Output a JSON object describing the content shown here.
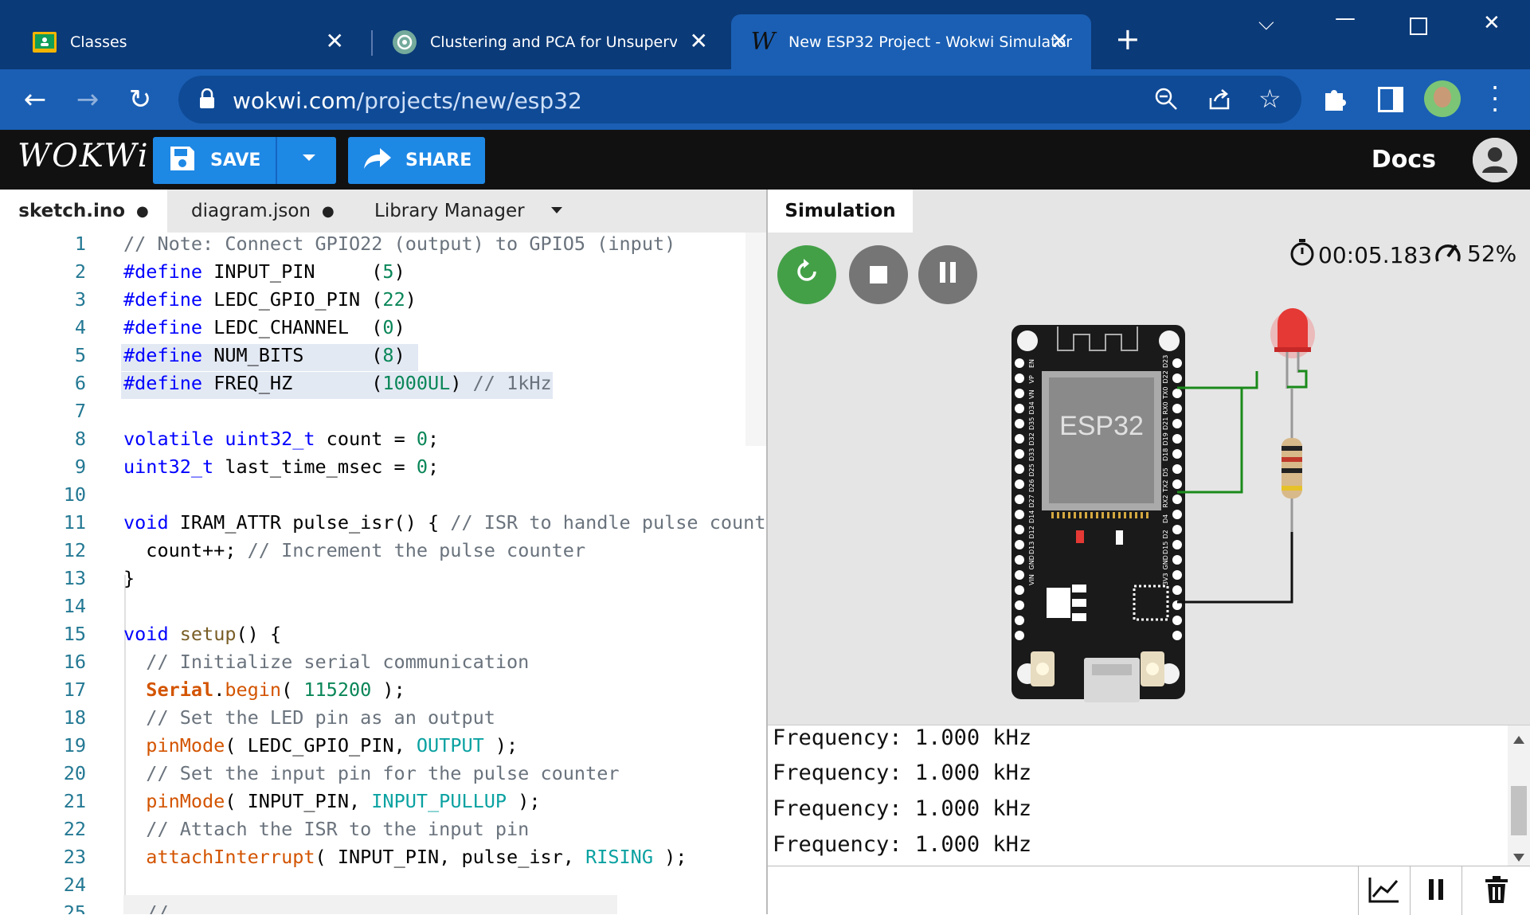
{
  "browser": {
    "tabs": [
      {
        "title": "Classes"
      },
      {
        "title": "Clustering and PCA for Unsupervised Le"
      },
      {
        "title": "New ESP32 Project - Wokwi Simulator"
      }
    ],
    "new_tab_label": "+",
    "url_host": "wokwi.com",
    "url_path": "/projects/new/esp32"
  },
  "wokwi": {
    "logo": "WOKWi",
    "save_label": "SAVE",
    "share_label": "SHARE",
    "docs_label": "Docs"
  },
  "editor": {
    "tabs": [
      {
        "label": "sketch.ino",
        "modified": "●"
      },
      {
        "label": "diagram.json",
        "modified": "●"
      },
      {
        "label": "Library Manager"
      }
    ],
    "line_numbers": [
      "1",
      "2",
      "3",
      "4",
      "5",
      "6",
      "7",
      "8",
      "9",
      "10",
      "11",
      "12",
      "13",
      "14",
      "15",
      "16",
      "17",
      "18",
      "19",
      "20",
      "21",
      "22",
      "23",
      "24",
      "25"
    ],
    "lines": [
      "// Note: Connect GPIO22 (output) to GPIO5 (input)",
      "#define INPUT_PIN     (5)",
      "#define LEDC_GPIO_PIN (22)",
      "#define LEDC_CHANNEL  (0)",
      "#define NUM_BITS      (8)",
      "#define FREQ_HZ       (1000UL) // 1kHz",
      "",
      "volatile uint32_t count = 0;",
      "uint32_t last_time_msec = 0;",
      "",
      "void IRAM_ATTR pulse_isr() { // ISR to handle pulse count",
      "  count++; // Increment the pulse counter",
      "}",
      "",
      "void setup() {",
      "  // Initialize serial communication",
      "  Serial.begin( 115200 );",
      "  // Set the LED pin as an output",
      "  pinMode( LEDC_GPIO_PIN, OUTPUT );",
      "  // Set the input pin for the pulse counter",
      "  pinMode( INPUT_PIN, INPUT_PULLUP );",
      "  // Attach the ISR to the input pin",
      "  attachInterrupt( INPUT_PIN, pulse_isr, RISING );",
      "",
      "  // ..."
    ]
  },
  "simulation": {
    "tab_label": "Simulation",
    "timer": "00:05.183",
    "speed": "52%",
    "chip_label": "ESP32",
    "left_pins": [
      "EN",
      "VP",
      "VN",
      "D34",
      "D35",
      "D32",
      "D33",
      "D25",
      "D26",
      "D27",
      "D14",
      "D12",
      "D13",
      "GND",
      "VIN"
    ],
    "right_pins": [
      "D23",
      "D22",
      "TX0",
      "RX0",
      "D21",
      "D19",
      "D18",
      "D5",
      "TX2",
      "RX2",
      "D4",
      "D2",
      "D15",
      "GND",
      "3V3"
    ]
  },
  "serial": {
    "lines": [
      "Frequency: 1.000 kHz",
      "Frequency: 1.000 kHz",
      "Frequency: 1.000 kHz",
      "Frequency: 1.000 kHz"
    ]
  }
}
